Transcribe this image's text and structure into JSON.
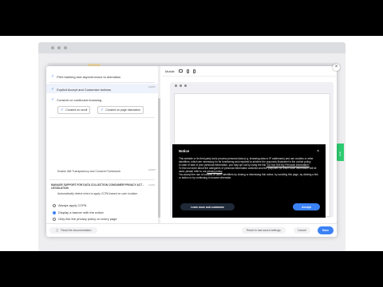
{
  "window": {
    "green_tab_label": "Help"
  },
  "left_panel": {
    "options": [
      {
        "label": "Print banking and asynchronous to animation",
        "checked": true
      },
      {
        "label": "Explicit Accept and Customize buttons",
        "checked": true,
        "code": "GDPR"
      },
      {
        "label": "Consent on continued browsing",
        "checked": true
      }
    ],
    "sub_options": [
      {
        "label": "Consent on scroll"
      },
      {
        "label": "Consent on page interaction"
      }
    ],
    "tcf_label": "Enable IAB Transparency and Consent Framework",
    "tcf_code": "GDPR",
    "ccpa_section_title": "MANAGE SUPPORT FOR DATA COLLECTION CONSUMER PRIVACY ACT - LEGISLATION",
    "ccpa_code": "CCPA",
    "ccpa_body": "Automatically detect when to apply CCPA based on user location",
    "radios": [
      {
        "label": "Always apply CCPA",
        "selected": false
      },
      {
        "label": "Display a banner with the notice",
        "selected": true
      },
      {
        "label": "Only link the privacy policy on every page",
        "selected": false
      }
    ]
  },
  "right_panel": {
    "device_label": "Mobile"
  },
  "notice": {
    "title": "Notice",
    "close": "×",
    "p1": "This website or its third-party tools process personal data (e.g. browsing data or IP addresses) and use cookies or other identifiers, which are necessary for its functioning and required to achieve the purposes illustrated in the cookie policy.",
    "p2": "In case of sale of your personal information, you may opt out by using the link",
    "p2_link": "\"Do Not Sell My Personal Information\"",
    "p3": "To find out more about the categories of personal information collected and the purposes for which such information will be used, please refer to our",
    "p3_link": "privacy policy",
    "p4": "You accept the use of cookies or other identifiers by closing or dismissing this notice, by scrolling this page, by clicking a link or button or by continuing to browse otherwise.",
    "learn_label": "Learn more and customize",
    "accept_label": "Accept"
  },
  "footer": {
    "docs_label": "Read the documentation",
    "reset_label": "Reset to last saved settings",
    "cancel_label": "Cancel",
    "save_label": "Save"
  },
  "colors": {
    "accent": "#3b82f6",
    "notice_bg": "#000000",
    "green_tab": "#2ecc71"
  }
}
